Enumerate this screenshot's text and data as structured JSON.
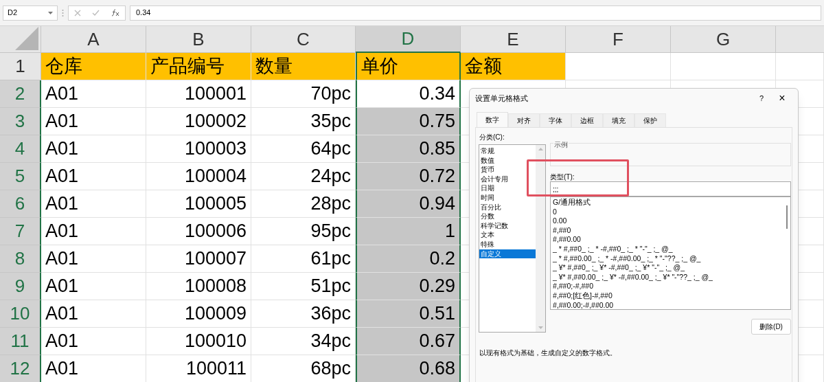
{
  "name_box": "D2",
  "formula_value": "0.34",
  "columns": [
    {
      "label": "A",
      "selected": false
    },
    {
      "label": "B",
      "selected": false
    },
    {
      "label": "C",
      "selected": false
    },
    {
      "label": "D",
      "selected": true
    },
    {
      "label": "E",
      "selected": false
    },
    {
      "label": "F",
      "selected": false
    },
    {
      "label": "G",
      "selected": false
    }
  ],
  "rows": [
    {
      "number": "1",
      "selected": false,
      "header_row": true,
      "cells": [
        "仓库",
        "产品编号",
        "数量",
        "单价",
        "金额"
      ]
    },
    {
      "number": "2",
      "selected": true,
      "header_row": false,
      "cells": [
        "A01",
        "100001",
        "70pc",
        "0.34"
      ]
    },
    {
      "number": "3",
      "selected": true,
      "header_row": false,
      "cells": [
        "A01",
        "100002",
        "35pc",
        "0.75"
      ]
    },
    {
      "number": "4",
      "selected": true,
      "header_row": false,
      "cells": [
        "A01",
        "100003",
        "64pc",
        "0.85"
      ]
    },
    {
      "number": "5",
      "selected": true,
      "header_row": false,
      "cells": [
        "A01",
        "100004",
        "24pc",
        "0.72"
      ]
    },
    {
      "number": "6",
      "selected": true,
      "header_row": false,
      "cells": [
        "A01",
        "100005",
        "28pc",
        "0.94"
      ]
    },
    {
      "number": "7",
      "selected": true,
      "header_row": false,
      "cells": [
        "A01",
        "100006",
        "95pc",
        "1"
      ]
    },
    {
      "number": "8",
      "selected": true,
      "header_row": false,
      "cells": [
        "A01",
        "100007",
        "61pc",
        "0.2"
      ]
    },
    {
      "number": "9",
      "selected": true,
      "header_row": false,
      "cells": [
        "A01",
        "100008",
        "51pc",
        "0.29"
      ]
    },
    {
      "number": "10",
      "selected": true,
      "header_row": false,
      "cells": [
        "A01",
        "100009",
        "36pc",
        "0.51"
      ]
    },
    {
      "number": "11",
      "selected": true,
      "header_row": false,
      "cells": [
        "A01",
        "100010",
        "34pc",
        "0.67"
      ]
    },
    {
      "number": "12",
      "selected": true,
      "header_row": false,
      "cells": [
        "A01",
        "100011",
        "68pc",
        "0.68"
      ]
    }
  ],
  "dialog": {
    "title": "设置单元格格式",
    "help": "?",
    "close": "×",
    "tabs": [
      {
        "label": "数字",
        "selected": true
      },
      {
        "label": "对齐",
        "selected": false
      },
      {
        "label": "字体",
        "selected": false
      },
      {
        "label": "边框",
        "selected": false
      },
      {
        "label": "填充",
        "selected": false
      },
      {
        "label": "保护",
        "selected": false
      }
    ],
    "category_label": "分类(C):",
    "categories": [
      {
        "label": "常规",
        "selected": false
      },
      {
        "label": "数值",
        "selected": false
      },
      {
        "label": "货币",
        "selected": false
      },
      {
        "label": "会计专用",
        "selected": false
      },
      {
        "label": "日期",
        "selected": false
      },
      {
        "label": "时间",
        "selected": false
      },
      {
        "label": "百分比",
        "selected": false
      },
      {
        "label": "分数",
        "selected": false
      },
      {
        "label": "科学记数",
        "selected": false
      },
      {
        "label": "文本",
        "selected": false
      },
      {
        "label": "特殊",
        "selected": false
      },
      {
        "label": "自定义",
        "selected": true
      }
    ],
    "sample_label": "示例",
    "type_label": "类型(T):",
    "type_value": ";;;",
    "formats": [
      "G/通用格式",
      "0",
      "0.00",
      "#,##0",
      "#,##0.00",
      "_ * #,##0_ ;_ * -#,##0_ ;_ * \"-\"_ ;_ @_",
      "_ * #,##0.00_ ;_ * -#,##0.00_ ;_ * \"-\"??_ ;_ @_",
      "_ ¥* #,##0_ ;_ ¥* -#,##0_ ;_ ¥* \"-\"_ ;_ @_",
      "_ ¥* #,##0.00_ ;_ ¥* -#,##0.00_ ;_ ¥* \"-\"??_ ;_ @_",
      "#,##0;-#,##0",
      "#,##0;[红色]-#,##0",
      "#,##0.00;-#,##0.00"
    ],
    "delete_button": "删除(D)",
    "description": "以现有格式为基础，生成自定义的数字格式。"
  }
}
